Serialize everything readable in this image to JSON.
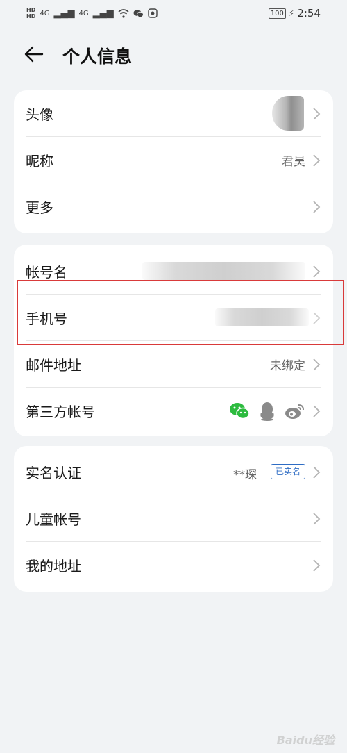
{
  "status_bar": {
    "hd_top": "HD",
    "hd_bottom": "HD",
    "network1": "4G",
    "network2": "4G",
    "battery": "100",
    "time": "2:54"
  },
  "header": {
    "title": "个人信息",
    "back_icon": "back-arrow-icon"
  },
  "profile_section": {
    "avatar_label": "头像",
    "nickname_label": "昵称",
    "nickname_value": "君昊",
    "more_label": "更多"
  },
  "account_section": {
    "account_name_label": "帐号名",
    "phone_label": "手机号",
    "email_label": "邮件地址",
    "email_value": "未绑定",
    "third_party_label": "第三方帐号",
    "third_party_icons": [
      "wechat-icon",
      "qq-icon",
      "weibo-icon"
    ]
  },
  "identity_section": {
    "realname_label": "实名认证",
    "realname_value": "**琛",
    "realname_badge": "已实名",
    "children_label": "儿童帐号",
    "address_label": "我的地址"
  },
  "watermark": "Baidu经验",
  "colors": {
    "background": "#f1f3f5",
    "card": "#ffffff",
    "badge_blue": "#2e6cc4",
    "highlight_red": "#d93a3a",
    "wechat_green": "#2dbb3f"
  }
}
